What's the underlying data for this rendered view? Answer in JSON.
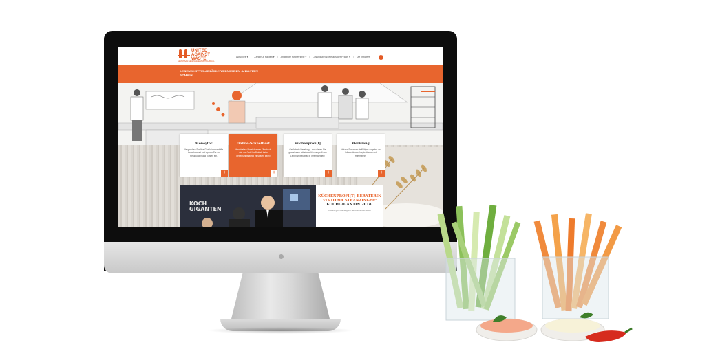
{
  "site": {
    "logo": {
      "line1": "UNITED",
      "line2": "AGAINST",
      "line3": "WASTE",
      "tagline": "GEMEINSAM GEGEN LEBENSMITTELABFALL"
    },
    "menu": [
      "Aktuelles ▾",
      "Zahlen & Fakten ▾",
      "Angebote für Betriebe ▾",
      "Lösungsbeispiele aus der Praxis ▾",
      "Die Initiative"
    ],
    "facebook_glyph": "f",
    "hero_title": "LEBENSMITTELABFÄLLE VERMEIDEN & KOSTEN SPAREN",
    "cards": [
      {
        "title": "Moneytor",
        "text": "Vergleichen Sie Ihre Großküchenabfälle branchenweit und sparen Sie an Ressourcen und Kosten ein.",
        "plus": "+"
      },
      {
        "title": "Online-Schnelltest",
        "text": "Verschaffen Sie sich einen Überblick, wie viel Geld Ihr Betrieb beim Lebensmittelabfall einsparen kann!",
        "plus": "+"
      },
      {
        "title": "Küchenprofi[t]",
        "text": "Geförderte Beratung – reduzieren Sie gemeinsam mit einem Küchenprofi den Lebensmittelabfall in Ihrem Betrieb!",
        "plus": "+"
      },
      {
        "title": "Werkzeug",
        "text": "Nutzen Sie unser vielfältiges Angebot an Informationen, Inspirationen und Hilfsmitteln!",
        "plus": "+"
      }
    ],
    "promo": {
      "photo_logo_line1": "KOCH",
      "photo_logo_line2": "GIGANTEN",
      "title": "KÜCHENPROFI[T] BERATERIN VIKTORIA STRANZINGER:",
      "subtitle": "KOCHGIGANTIN 2018!",
      "text": "Viktoria geht als Siegerin der Kochshow hervor"
    }
  },
  "colors": {
    "brand": "#e8652e",
    "bezel": "#0d0d0d"
  }
}
